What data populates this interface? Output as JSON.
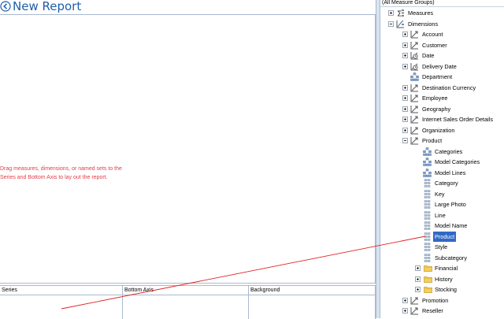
{
  "report": {
    "title": "New Report",
    "hint_line1": "Drag measures, dimensions, or named sets to the",
    "hint_line2": "Series and Bottom Axis to lay out the report."
  },
  "drop_zones": [
    {
      "label": "Series"
    },
    {
      "label": "Bottom Axis"
    },
    {
      "label": "Background"
    }
  ],
  "measure_group_combo": "(All Measure Groups)",
  "tree": [
    {
      "label": "Measures",
      "icon": "sigma-icon",
      "expander": "plus"
    },
    {
      "label": "Dimensions",
      "icon": "dimensions-icon",
      "expander": "minus"
    },
    {
      "label": "Account",
      "icon": "dimension-icon",
      "expander": "plus"
    },
    {
      "label": "Customer",
      "icon": "dimension-icon",
      "expander": "plus"
    },
    {
      "label": "Date",
      "icon": "time-dimension-icon",
      "expander": "plus"
    },
    {
      "label": "Delivery Date",
      "icon": "time-dimension-icon",
      "expander": "plus"
    },
    {
      "label": "Department",
      "icon": "hierarchy-icon",
      "expander": "none"
    },
    {
      "label": "Destination Currency",
      "icon": "dimension-icon",
      "expander": "plus"
    },
    {
      "label": "Employee",
      "icon": "dimension-icon",
      "expander": "plus"
    },
    {
      "label": "Geography",
      "icon": "dimension-icon",
      "expander": "plus"
    },
    {
      "label": "Internet Sales Order Details",
      "icon": "dimension-icon",
      "expander": "plus"
    },
    {
      "label": "Organization",
      "icon": "dimension-icon",
      "expander": "plus"
    },
    {
      "label": "Product",
      "icon": "dimension-icon",
      "expander": "minus"
    },
    {
      "label": "Categories",
      "icon": "hierarchy-icon",
      "expander": "none"
    },
    {
      "label": "Model Categories",
      "icon": "hierarchy-icon",
      "expander": "none"
    },
    {
      "label": "Model Lines",
      "icon": "hierarchy-icon",
      "expander": "none"
    },
    {
      "label": "Category",
      "icon": "attribute-icon",
      "expander": "none"
    },
    {
      "label": "Key",
      "icon": "attribute-icon",
      "expander": "none"
    },
    {
      "label": "Large Photo",
      "icon": "attribute-icon",
      "expander": "none"
    },
    {
      "label": "Line",
      "icon": "attribute-icon",
      "expander": "none"
    },
    {
      "label": "Model Name",
      "icon": "attribute-icon",
      "expander": "none"
    },
    {
      "label": "Product",
      "icon": "attribute-icon",
      "expander": "none",
      "selected": true
    },
    {
      "label": "Style",
      "icon": "attribute-icon",
      "expander": "none"
    },
    {
      "label": "Subcategory",
      "icon": "attribute-icon",
      "expander": "none"
    },
    {
      "label": "Financial",
      "icon": "folder-icon",
      "expander": "plus"
    },
    {
      "label": "History",
      "icon": "folder-icon",
      "expander": "plus"
    },
    {
      "label": "Stocking",
      "icon": "folder-icon",
      "expander": "plus"
    },
    {
      "label": "Promotion",
      "icon": "dimension-icon",
      "expander": "plus"
    },
    {
      "label": "Reseller",
      "icon": "dimension-icon",
      "expander": "plus"
    }
  ],
  "colors": {
    "title": "#1f5ea8",
    "hint": "#e0404a",
    "selection": "#316ac5",
    "drag_line": "#e02020"
  }
}
